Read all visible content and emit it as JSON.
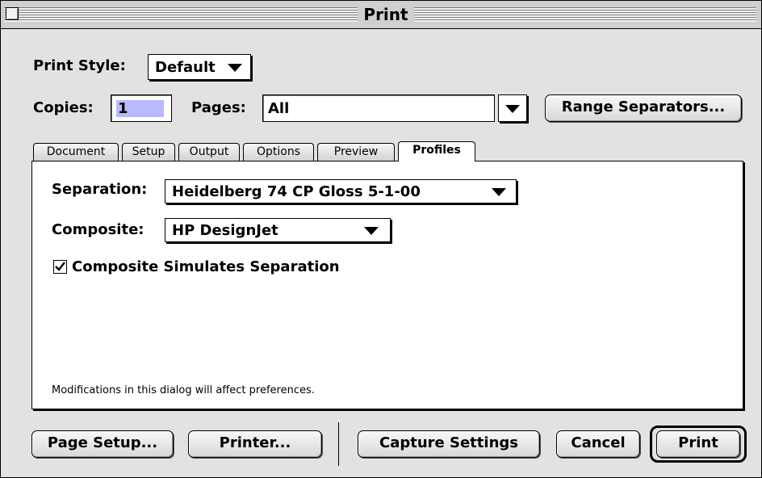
{
  "window": {
    "title": "Print"
  },
  "print_style": {
    "label": "Print Style:",
    "value": "Default"
  },
  "copies": {
    "label": "Copies:",
    "value": "1"
  },
  "pages": {
    "label": "Pages:",
    "value": "All"
  },
  "buttons": {
    "range_separators": "Range Separators...",
    "page_setup": "Page Setup...",
    "printer": "Printer...",
    "capture_settings": "Capture Settings",
    "cancel": "Cancel",
    "print": "Print"
  },
  "tabs": [
    {
      "label": "Document"
    },
    {
      "label": "Setup"
    },
    {
      "label": "Output"
    },
    {
      "label": "Options"
    },
    {
      "label": "Preview"
    },
    {
      "label": "Profiles",
      "active": true
    }
  ],
  "profiles": {
    "separation": {
      "label": "Separation:",
      "value": "Heidelberg 74 CP Gloss 5-1-00"
    },
    "composite": {
      "label": "Composite:",
      "value": "HP DesignJet"
    },
    "simulate": {
      "label": "Composite Simulates Separation",
      "checked": true
    },
    "note": "Modifications in this dialog will affect preferences."
  },
  "colors": {
    "copies_field_highlight": "#b9b9ff"
  }
}
